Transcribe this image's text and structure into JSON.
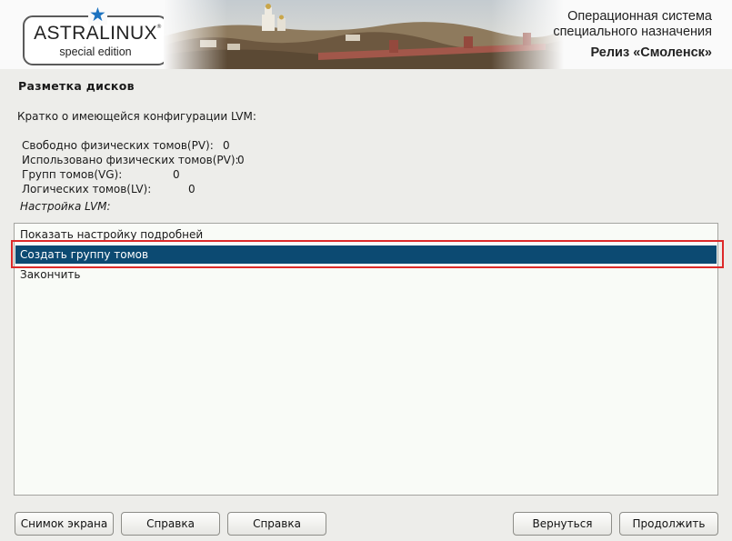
{
  "header": {
    "logo_name": "ASTRALINUX",
    "logo_reg": "®",
    "logo_edition": "special edition",
    "release_line1": "Операционная система",
    "release_line2": "специального назначения",
    "release_line3": "Релиз «Смоленск»"
  },
  "page": {
    "title": "Разметка дисков",
    "summary_title": "Кратко о имеющейся конфигурации LVM:",
    "stats": [
      {
        "label": "Свободно физических томов(PV):",
        "value": "0"
      },
      {
        "label": "Использовано физических томов(PV):",
        "value": "0"
      },
      {
        "label": "Групп томов(VG):",
        "value": "0"
      },
      {
        "label": "Логических томов(LV):",
        "value": "0"
      }
    ],
    "lvm_label": "Настройка LVM:"
  },
  "options": [
    {
      "label": "Показать настройку подробней",
      "selected": false
    },
    {
      "label": "Создать группу томов",
      "selected": true
    },
    {
      "label": "Закончить",
      "selected": false
    }
  ],
  "buttons": {
    "screenshot": "Снимок экрана",
    "help1": "Справка",
    "help2": "Справка",
    "back": "Вернуться",
    "continue": "Продолжить"
  },
  "colors": {
    "selection": "#0c4a72",
    "highlight_frame": "#dd2a2a",
    "logo_star": "#1d73c0"
  }
}
